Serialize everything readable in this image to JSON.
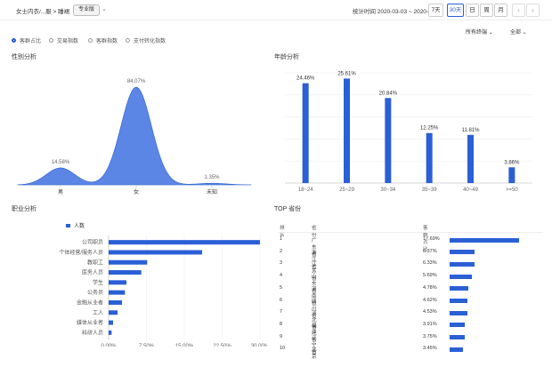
{
  "header": {
    "breadcrumb": "女士内衣/...服 > 睡裙",
    "badge": "专业版",
    "date_range": "统计时间 2020-03-03 ~ 2020-04-01",
    "periods": [
      "7天",
      "30天",
      "日",
      "周",
      "月"
    ],
    "active_period": "30天",
    "prev_icon": "chevron-left-icon",
    "next_icon": "chevron-right-icon"
  },
  "filters": {
    "terminal": "所有终端",
    "scope": "全部"
  },
  "metric_tabs": [
    "客群占比",
    "交易指数",
    "客群指数",
    "支付转化指数"
  ],
  "sections": {
    "gender": "性别分析",
    "age": "年龄分析",
    "occupation": "职业分析",
    "top_province": "TOP 省份"
  },
  "colors": {
    "accent": "#2a5fd6",
    "area": "#5b86e5"
  },
  "chart_data": [
    {
      "type": "area",
      "title": "性别分析",
      "categories": [
        "男",
        "女",
        "未知"
      ],
      "values": [
        14.58,
        84.07,
        1.35
      ],
      "value_labels": [
        "14.58%",
        "84.07%",
        "1.35%"
      ],
      "grid": false
    },
    {
      "type": "bar",
      "title": "年龄分析",
      "categories": [
        "18~24",
        "25~29",
        "30~34",
        "35~39",
        "40~49",
        ">=50"
      ],
      "values": [
        24.46,
        25.61,
        20.84,
        12.25,
        11.81,
        3.86
      ],
      "value_labels": [
        "24.46%",
        "25.61%",
        "20.84%",
        "12.25%",
        "11.81%",
        "3.86%"
      ],
      "grid": true
    },
    {
      "type": "bar",
      "orientation": "horizontal",
      "title": "职业分析",
      "legend": "人数",
      "categories": [
        "公司职员",
        "个体经营/服务人员",
        "教职工",
        "医务人员",
        "学生",
        "公务员",
        "金融从业者",
        "工人",
        "媒体从业者",
        "科研人员"
      ],
      "values": [
        10.2,
        6.3,
        2.6,
        2.2,
        1.2,
        1.1,
        0.9,
        0.6,
        0.3,
        0.2
      ],
      "xticks": [
        "0.00%",
        "7.50%",
        "15.00%",
        "22.50%",
        "30.00%"
      ],
      "xlim": [
        0,
        10.2
      ],
      "grid": true
    },
    {
      "type": "table",
      "title": "TOP 省份",
      "columns": [
        "排名",
        "省份",
        "客群占比"
      ],
      "rows": [
        {
          "rank": "1",
          "province": "广东省",
          "share": "17.69%",
          "value": 17.69
        },
        {
          "rank": "2",
          "province": "浙江省",
          "share": "6.37%",
          "value": 6.37
        },
        {
          "rank": "3",
          "province": "江苏省",
          "share": "6.33%",
          "value": 6.33
        },
        {
          "rank": "4",
          "province": "山东省",
          "share": "5.69%",
          "value": 5.69
        },
        {
          "rank": "5",
          "province": "河南省",
          "share": "4.78%",
          "value": 4.78
        },
        {
          "rank": "6",
          "province": "四川省",
          "share": "4.62%",
          "value": 4.62
        },
        {
          "rank": "7",
          "province": "河北省",
          "share": "4.53%",
          "value": 4.53
        },
        {
          "rank": "8",
          "province": "福建省",
          "share": "3.91%",
          "value": 3.91
        },
        {
          "rank": "9",
          "province": "辽宁省",
          "share": "3.75%",
          "value": 3.75
        },
        {
          "rank": "10",
          "province": "北京",
          "share": "3.45%",
          "value": 3.45
        }
      ]
    }
  ]
}
